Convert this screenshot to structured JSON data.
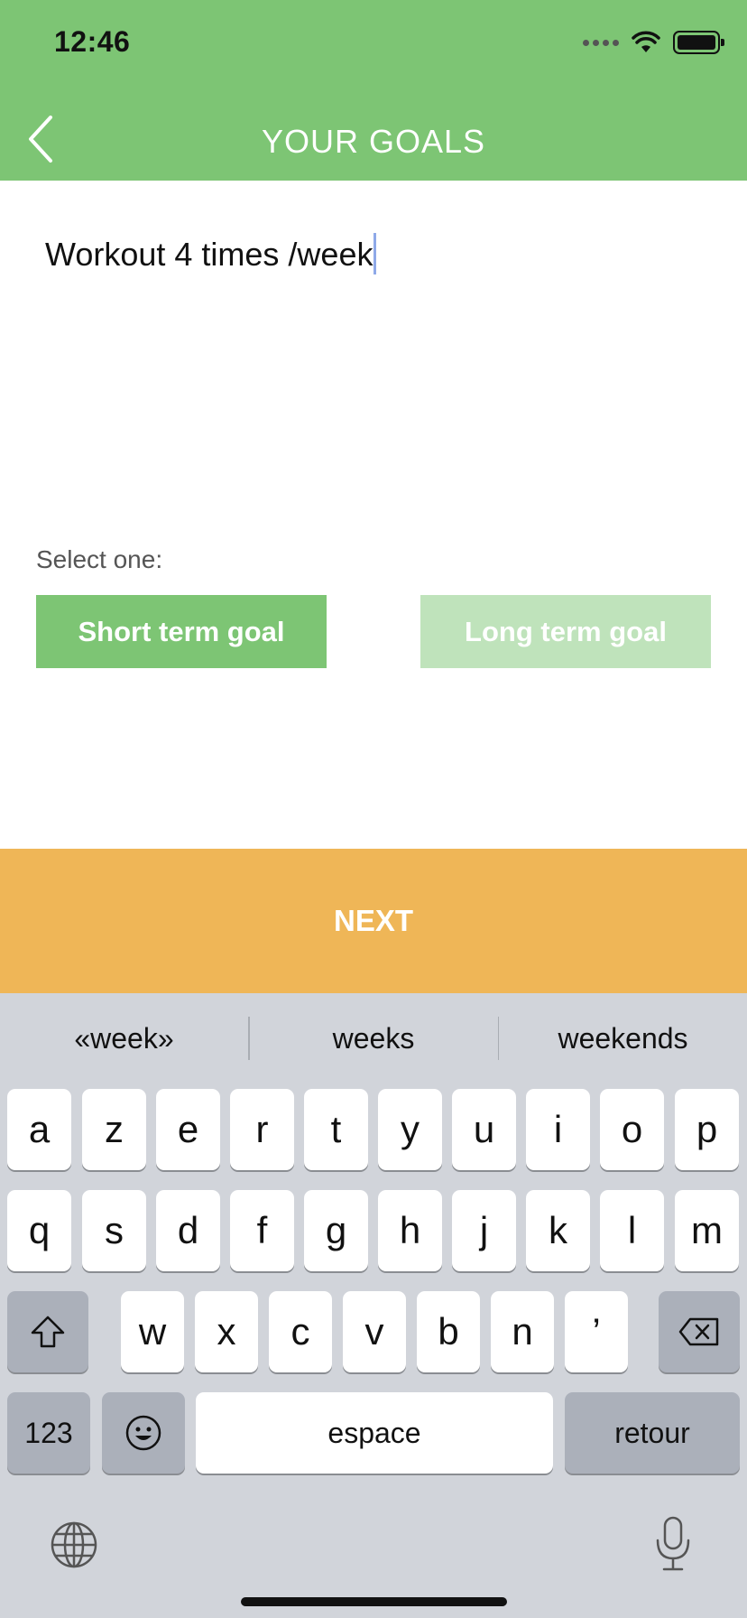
{
  "status": {
    "time": "12:46"
  },
  "header": {
    "title": "YOUR GOALS"
  },
  "goal": {
    "text": "Workout 4 times /week"
  },
  "selection": {
    "label": "Select one:",
    "short_label": "Short term goal",
    "long_label": "Long term goal",
    "selected": "short"
  },
  "next_label": "NEXT",
  "keyboard": {
    "suggestions": [
      "«week»",
      "weeks",
      "weekends"
    ],
    "row1": [
      "a",
      "z",
      "e",
      "r",
      "t",
      "y",
      "u",
      "i",
      "o",
      "p"
    ],
    "row2": [
      "q",
      "s",
      "d",
      "f",
      "g",
      "h",
      "j",
      "k",
      "l",
      "m"
    ],
    "row3": [
      "w",
      "x",
      "c",
      "v",
      "b",
      "n",
      "’"
    ],
    "numbers_label": "123",
    "space_label": "espace",
    "return_label": "retour"
  },
  "colors": {
    "header": "#7DC574",
    "primary": "#7DC574",
    "primary_light": "#BFE3BB",
    "next": "#EFB657",
    "keyboard_bg": "#D1D4DA"
  }
}
